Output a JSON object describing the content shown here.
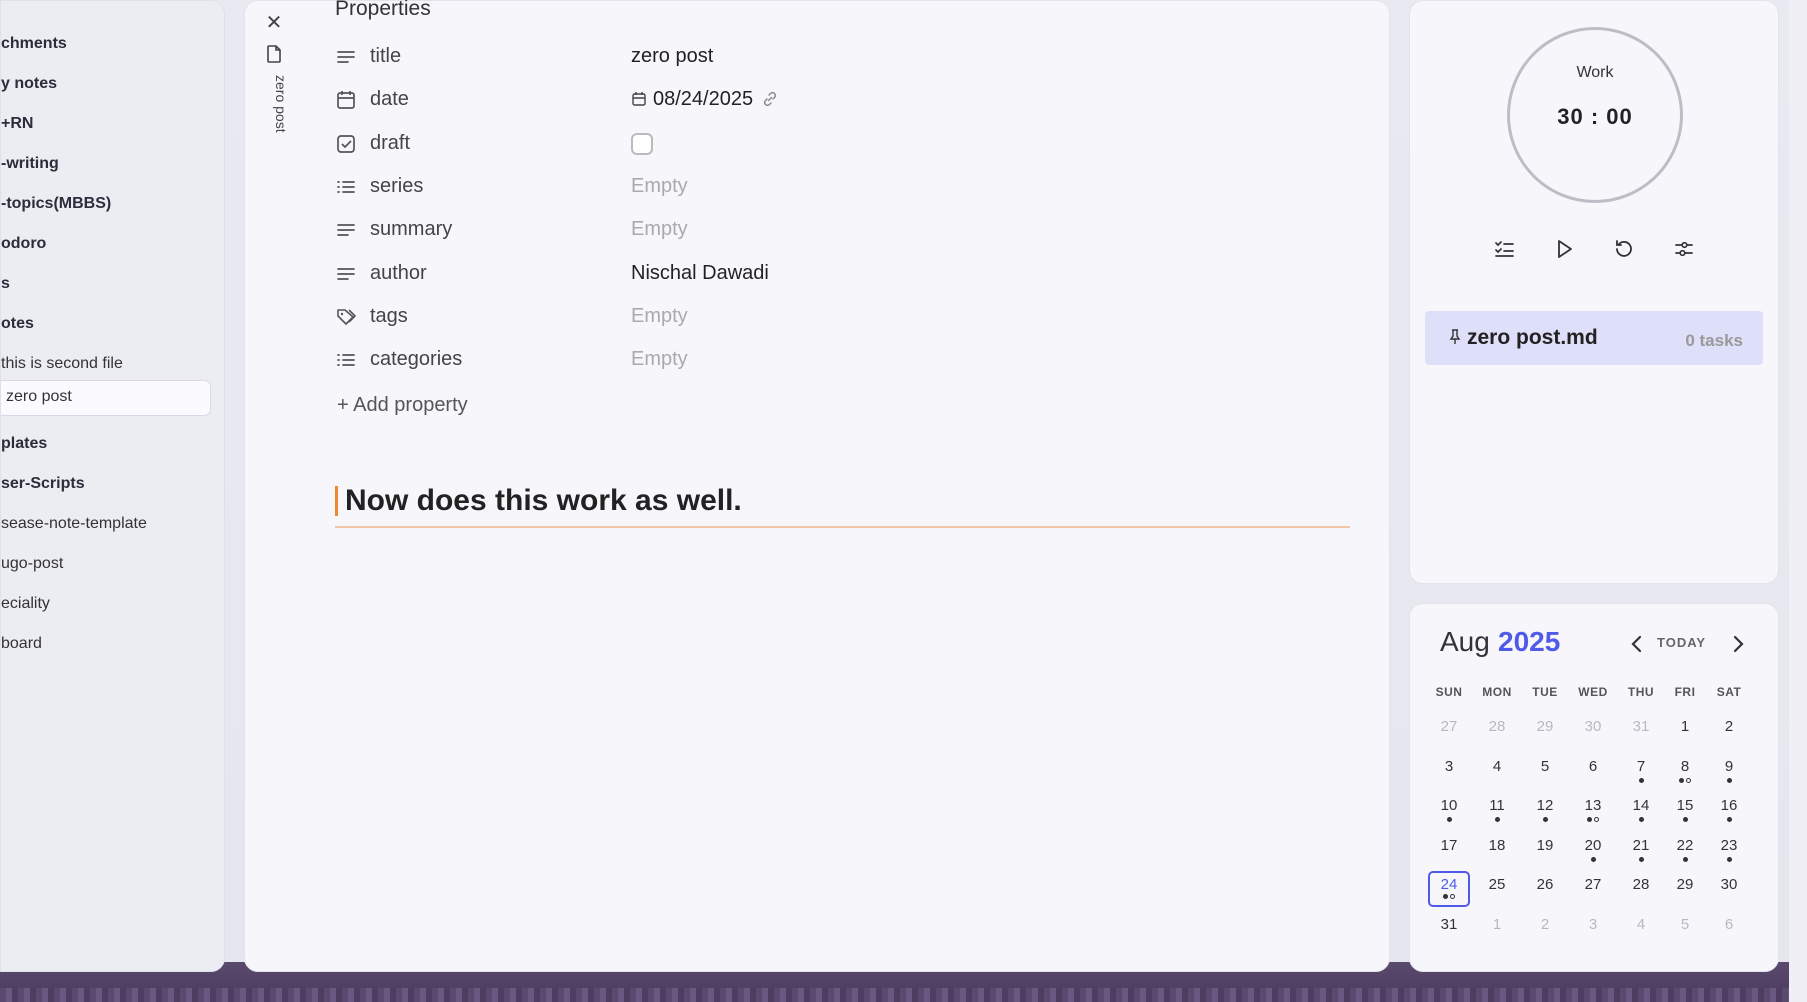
{
  "sidebar": {
    "items": [
      {
        "label": "chments",
        "bold": true
      },
      {
        "label": "y notes",
        "bold": true
      },
      {
        "label": "+RN",
        "bold": true
      },
      {
        "label": "-writing",
        "bold": true
      },
      {
        "label": "-topics(MBBS)",
        "bold": true
      },
      {
        "label": "odoro",
        "bold": true
      },
      {
        "label": "s",
        "bold": true
      },
      {
        "label": "otes",
        "bold": true
      },
      {
        "label": "this is second file",
        "bold": false
      },
      {
        "label": "zero post",
        "bold": false,
        "selected": true
      },
      {
        "label": "plates",
        "bold": true
      },
      {
        "label": "ser-Scripts",
        "bold": true
      },
      {
        "label": "sease-note-template",
        "bold": false
      },
      {
        "label": "ugo-post",
        "bold": false
      },
      {
        "label": "eciality",
        "bold": false
      },
      {
        "label": "board",
        "bold": false
      }
    ]
  },
  "tab": {
    "title": "zero post",
    "close_icon": "close-icon",
    "file_icon": "file-icon"
  },
  "properties": {
    "heading": "Properties",
    "rows": [
      {
        "key": "title",
        "value": "zero post",
        "icon": "text-lines-icon"
      },
      {
        "key": "date",
        "value": "08/24/2025",
        "icon": "calendar-icon"
      },
      {
        "key": "draft",
        "value": "",
        "icon": "checkbox-icon",
        "checked": false
      },
      {
        "key": "series",
        "value": "Empty",
        "icon": "list-icon"
      },
      {
        "key": "summary",
        "value": "Empty",
        "icon": "text-lines-icon"
      },
      {
        "key": "author",
        "value": "Nischal Dawadi",
        "icon": "text-lines-icon"
      },
      {
        "key": "tags",
        "value": "Empty",
        "icon": "tags-icon"
      },
      {
        "key": "categories",
        "value": "Empty",
        "icon": "list-icon"
      }
    ],
    "add_label": "Add property"
  },
  "content": {
    "heading": "Now does this work as well."
  },
  "timer": {
    "mode": "Work",
    "time": "30 : 00",
    "ring_color": "#bdbdc6"
  },
  "task": {
    "file": "zero post.md",
    "count": "0 tasks"
  },
  "calendar": {
    "month": "Aug",
    "year": "2025",
    "today_label": "TODAY",
    "accent": "#4f5be8",
    "weekdays": [
      "SUN",
      "MON",
      "TUE",
      "WED",
      "THU",
      "FRI",
      "SAT"
    ],
    "weeks": [
      [
        {
          "d": "27",
          "adj": true
        },
        {
          "d": "28",
          "adj": true
        },
        {
          "d": "29",
          "adj": true
        },
        {
          "d": "30",
          "adj": true
        },
        {
          "d": "31",
          "adj": true
        },
        {
          "d": "1"
        },
        {
          "d": "2"
        }
      ],
      [
        {
          "d": "3"
        },
        {
          "d": "4"
        },
        {
          "d": "5"
        },
        {
          "d": "6"
        },
        {
          "d": "7",
          "dots": "f"
        },
        {
          "d": "8",
          "dots": "fh"
        },
        {
          "d": "9",
          "dots": "f"
        }
      ],
      [
        {
          "d": "10",
          "dots": "f"
        },
        {
          "d": "11",
          "dots": "f"
        },
        {
          "d": "12",
          "dots": "f"
        },
        {
          "d": "13",
          "dots": "fh"
        },
        {
          "d": "14",
          "dots": "f"
        },
        {
          "d": "15",
          "dots": "f"
        },
        {
          "d": "16",
          "dots": "f"
        }
      ],
      [
        {
          "d": "17"
        },
        {
          "d": "18"
        },
        {
          "d": "19"
        },
        {
          "d": "20",
          "dots": "f"
        },
        {
          "d": "21",
          "dots": "f"
        },
        {
          "d": "22",
          "dots": "f"
        },
        {
          "d": "23",
          "dots": "f"
        }
      ],
      [
        {
          "d": "24",
          "today": true,
          "dots": "fh"
        },
        {
          "d": "25"
        },
        {
          "d": "26"
        },
        {
          "d": "27"
        },
        {
          "d": "28"
        },
        {
          "d": "29"
        },
        {
          "d": "30"
        }
      ],
      [
        {
          "d": "31"
        },
        {
          "d": "1",
          "adj": true
        },
        {
          "d": "2",
          "adj": true
        },
        {
          "d": "3",
          "adj": true
        },
        {
          "d": "4",
          "adj": true
        },
        {
          "d": "5",
          "adj": true
        },
        {
          "d": "6",
          "adj": true
        }
      ]
    ]
  }
}
